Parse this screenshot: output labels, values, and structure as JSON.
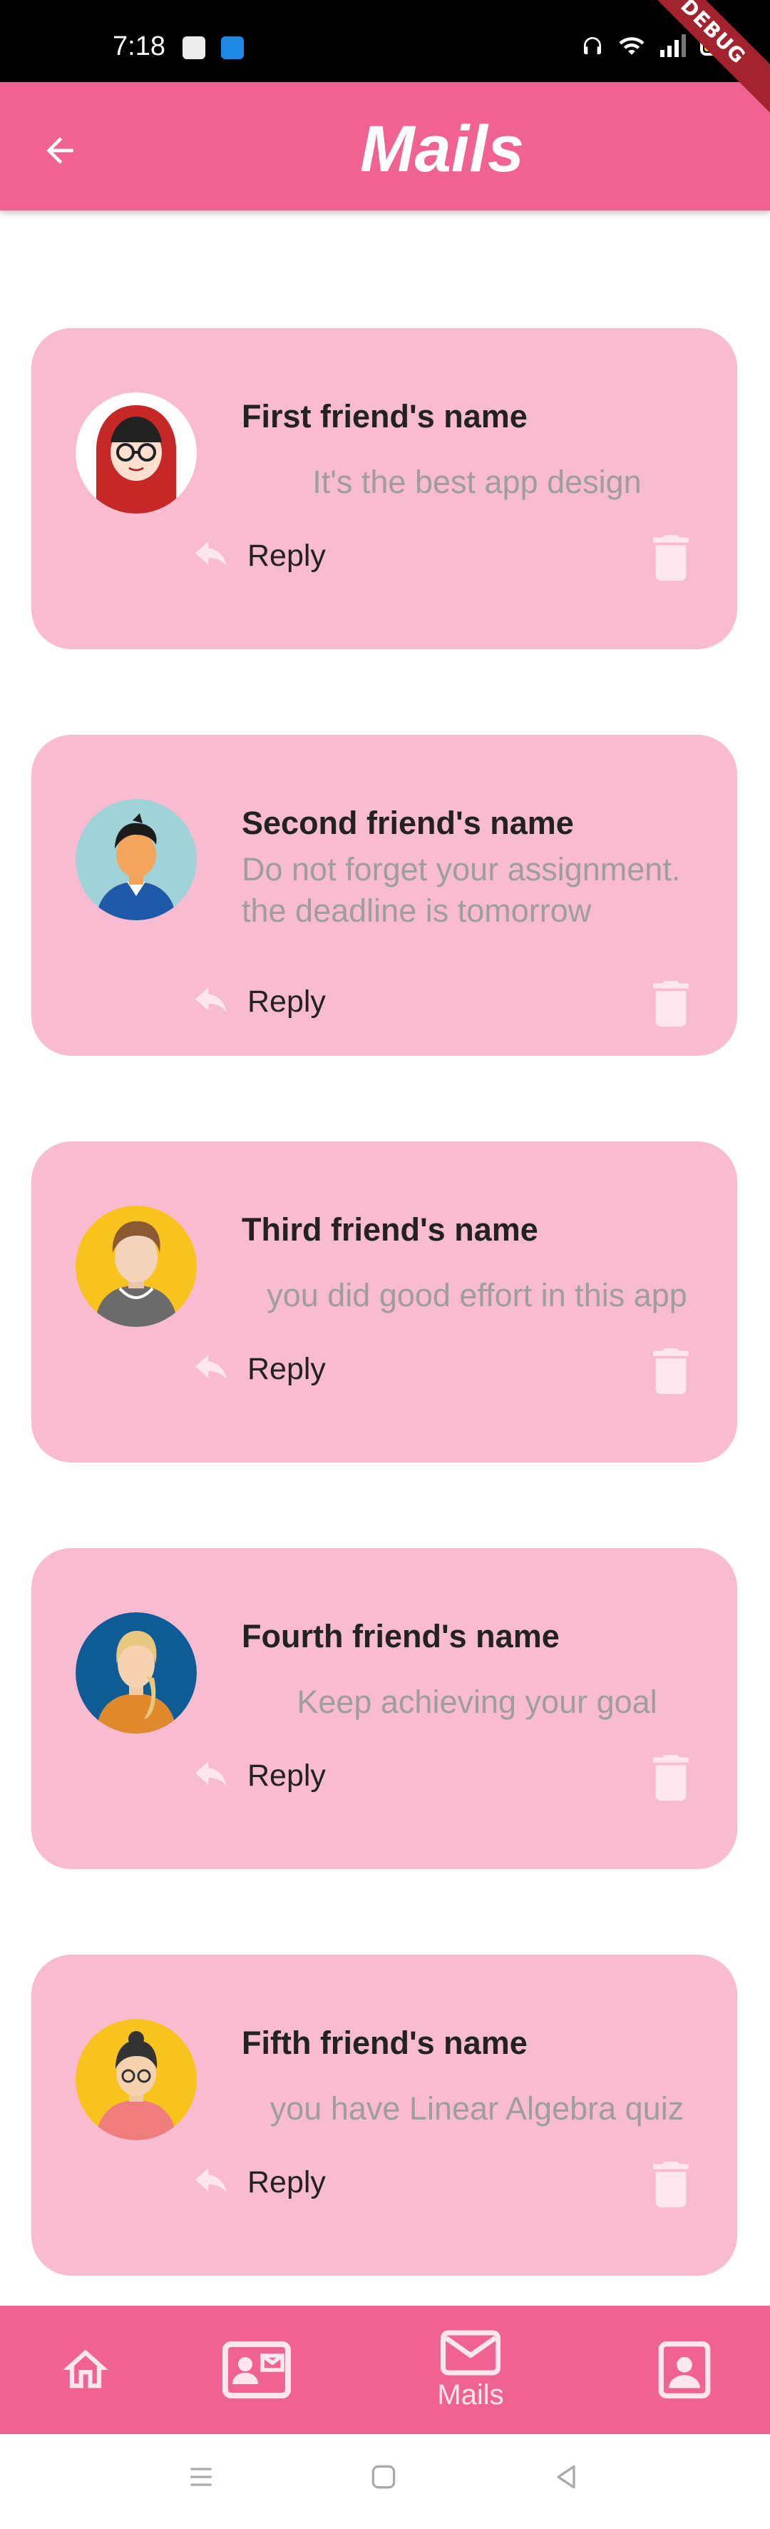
{
  "status_bar": {
    "time": "7:18"
  },
  "debug_badge": "DEBUG",
  "app_bar": {
    "title": "Mails"
  },
  "mails": [
    {
      "name": "First friend's name",
      "message": "It's the best app design",
      "reply_label": "Reply"
    },
    {
      "name": "Second friend's name",
      "message": "Do not forget your assignment. the deadline is tomorrow",
      "reply_label": "Reply"
    },
    {
      "name": "Third friend's name",
      "message": "you did good effort in this app",
      "reply_label": "Reply"
    },
    {
      "name": "Fourth friend's name",
      "message": "Keep achieving your goal",
      "reply_label": "Reply"
    },
    {
      "name": "Fifth friend's name",
      "message": "you have Linear Algebra quiz",
      "reply_label": "Reply"
    }
  ],
  "bottom_nav": {
    "items": [
      {
        "icon": "home-icon",
        "label": ""
      },
      {
        "icon": "contact-mail-icon",
        "label": ""
      },
      {
        "icon": "mail-icon",
        "label": "Mails"
      },
      {
        "icon": "contact-card-icon",
        "label": ""
      }
    ]
  },
  "colors": {
    "primary": "#f06292",
    "card": "#f8bbd0",
    "message_text": "#9e9e9e",
    "icon_light": "#fde6ee"
  }
}
